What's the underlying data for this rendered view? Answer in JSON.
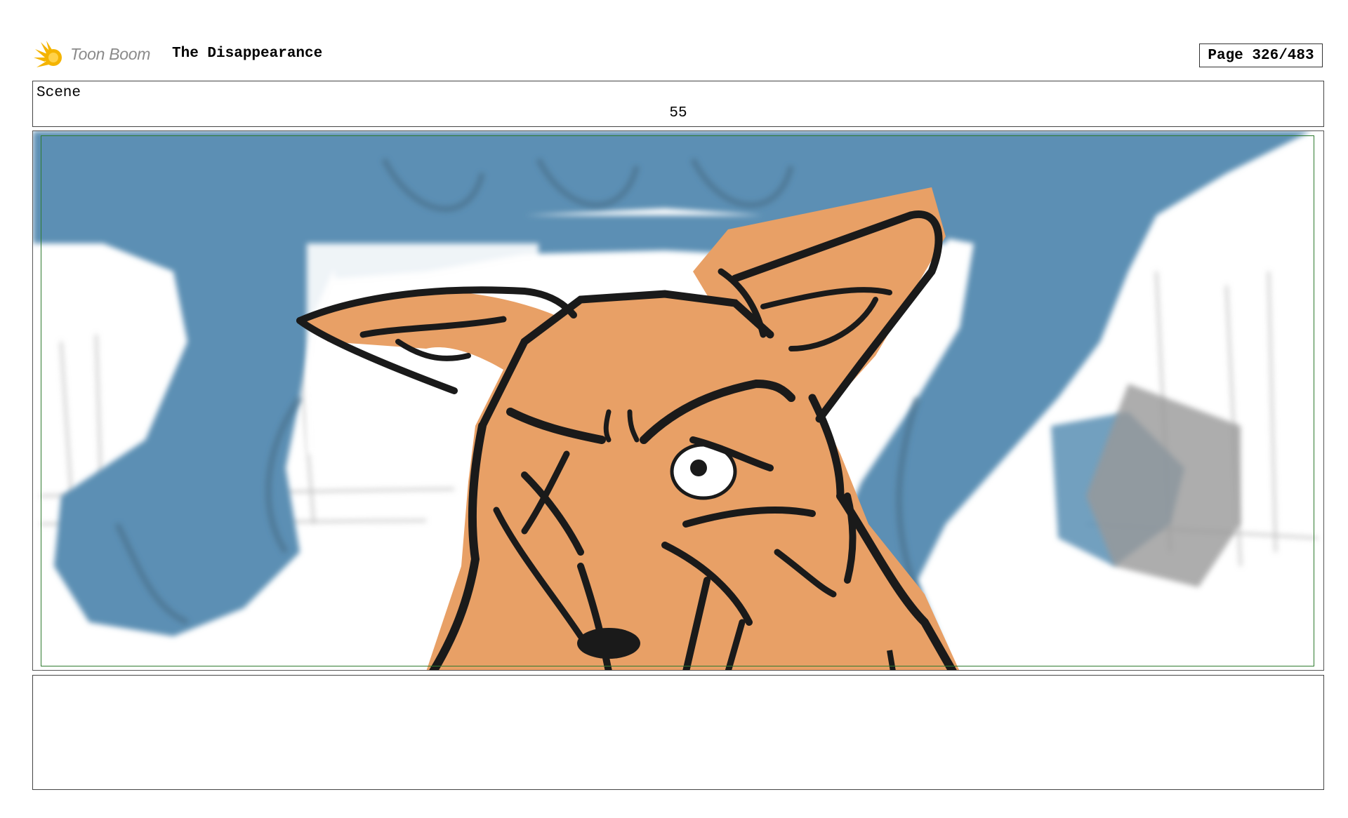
{
  "header": {
    "logo_text": "Toon Boom",
    "project_title": "The Disappearance",
    "page_indicator": "Page 326/483"
  },
  "scene": {
    "label": "Scene",
    "number": "55"
  },
  "panel": {
    "image_name": "storyboard-panel-fox-closeup",
    "colors": {
      "fox_fill": "#e8a066",
      "background_figure": "#5b8fb4",
      "safe_frame": "#2f7a2f",
      "ink": "#1a1a1a"
    }
  },
  "notes": {
    "text": ""
  }
}
